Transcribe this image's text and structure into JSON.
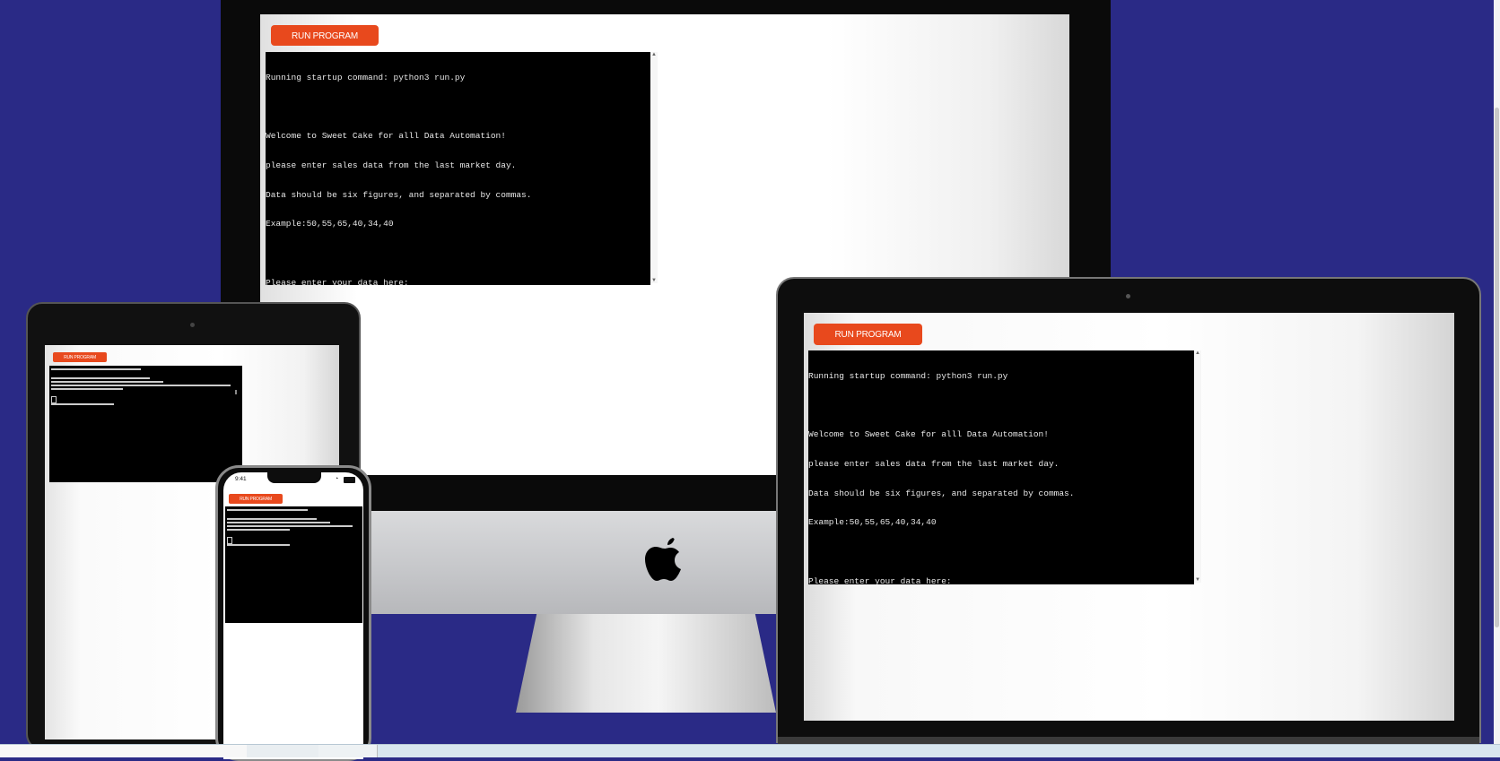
{
  "button": {
    "label": "RUN PROGRAM"
  },
  "terminal": {
    "lines": [
      "Running startup command: python3 run.py",
      "",
      "Welcome to Sweet Cake for alll Data Automation!",
      "please enter sales data from the last market day.",
      "Data should be six figures, and separated by commas.",
      "Example:50,55,65,40,34,40",
      "",
      "Please enter your data here:"
    ]
  },
  "phone": {
    "time": "9:41"
  },
  "colors": {
    "background": "#2a2a86",
    "button": "#e8491d",
    "terminal_bg": "#000000"
  },
  "icons": [
    "apple-logo-icon",
    "wifi-icon",
    "battery-icon",
    "signal-icon",
    "camera-icon"
  ]
}
